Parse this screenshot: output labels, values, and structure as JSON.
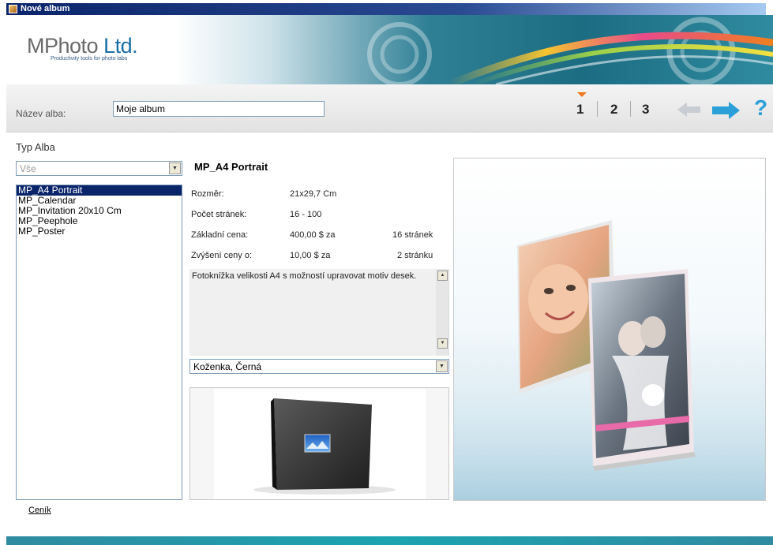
{
  "window": {
    "title": "Nové album"
  },
  "header": {
    "logo_main": "MPhoto Ltd.",
    "logo_prefix": "MPhoto",
    "logo_suffix": "Ltd.",
    "logo_tagline": "Productivity tools for photo labs"
  },
  "album_name": {
    "label": "Název alba:",
    "value": "Moje album"
  },
  "steps": {
    "items": [
      "1",
      "2",
      "3"
    ],
    "current": "1",
    "back_icon": "arrow-left-icon",
    "next_icon": "arrow-right-icon",
    "help_glyph": "?"
  },
  "album_type": {
    "label": "Typ Alba",
    "filter_value": "Vše",
    "items": [
      "MP_A4 Portrait",
      "MP_Calendar",
      "MP_Invitation 20x10 Cm",
      "MP_Peephole",
      "MP_Poster"
    ],
    "selected_index": 0
  },
  "details": {
    "title": "MP_A4 Portrait",
    "size_label": "Rozměr:",
    "size_value": "21x29,7 Cm",
    "pages_label": "Počet stránek:",
    "pages_value": "16 - 100",
    "base_price_label": "Základní cena:",
    "base_price_value": "400,00 $ za",
    "base_price_unit": "16 stránek",
    "increase_label": "Zvýšení ceny o:",
    "increase_value": "10,00 $ za",
    "increase_unit": "2 stránku",
    "description": "Fotoknížka velikosti A4 s možností upravovat motiv desek.",
    "material_value": "Koženka, Černá"
  },
  "footer": {
    "price_list_link": "Ceník"
  },
  "colors": {
    "selection": "#0a246a",
    "accent_arrow": "#2a9fd8",
    "step_marker": "#f07820",
    "banner_teal": "#1c6c82"
  }
}
